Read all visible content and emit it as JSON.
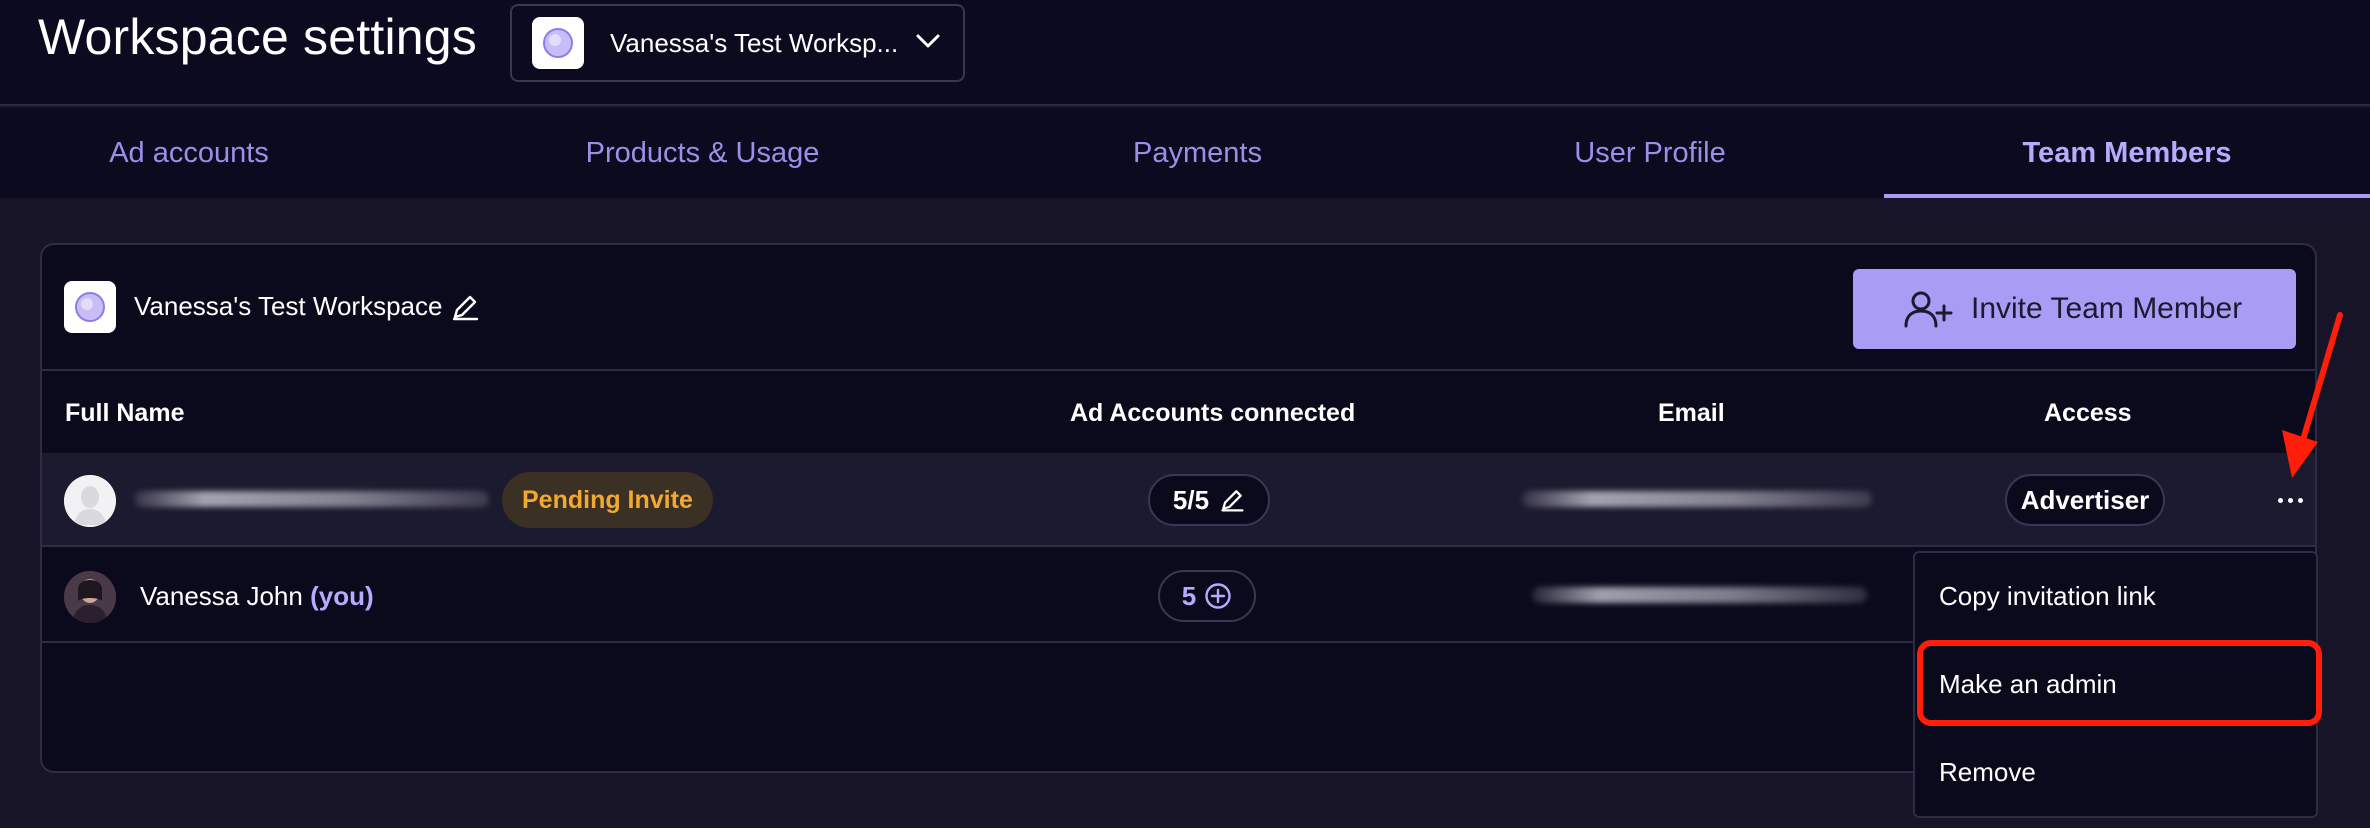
{
  "header": {
    "title": "Workspace settings",
    "workspace_select": "Vanessa's Test Worksp..."
  },
  "tabs": [
    {
      "label": "Ad accounts"
    },
    {
      "label": "Products & Usage"
    },
    {
      "label": "Payments"
    },
    {
      "label": "User Profile"
    },
    {
      "label": "Team Members",
      "active": true
    }
  ],
  "card": {
    "workspace_name": "Vanessa's Test Workspace",
    "invite_label": "Invite Team Member"
  },
  "table": {
    "columns": [
      "Full Name",
      "Ad Accounts connected",
      "Email",
      "Access"
    ],
    "rows": [
      {
        "status": "Pending Invite",
        "ad_accounts": "5/5",
        "access": "Advertiser"
      },
      {
        "name": "Vanessa John",
        "you": "(you)",
        "ad_accounts": "5"
      }
    ]
  },
  "menu": {
    "items": [
      "Copy invitation link",
      "Make an admin",
      "Remove"
    ]
  },
  "colors": {
    "accent": "#a89cf5",
    "pending": "#f3a930",
    "annotation": "#ff1e0a",
    "background": "#0b0a1d"
  }
}
